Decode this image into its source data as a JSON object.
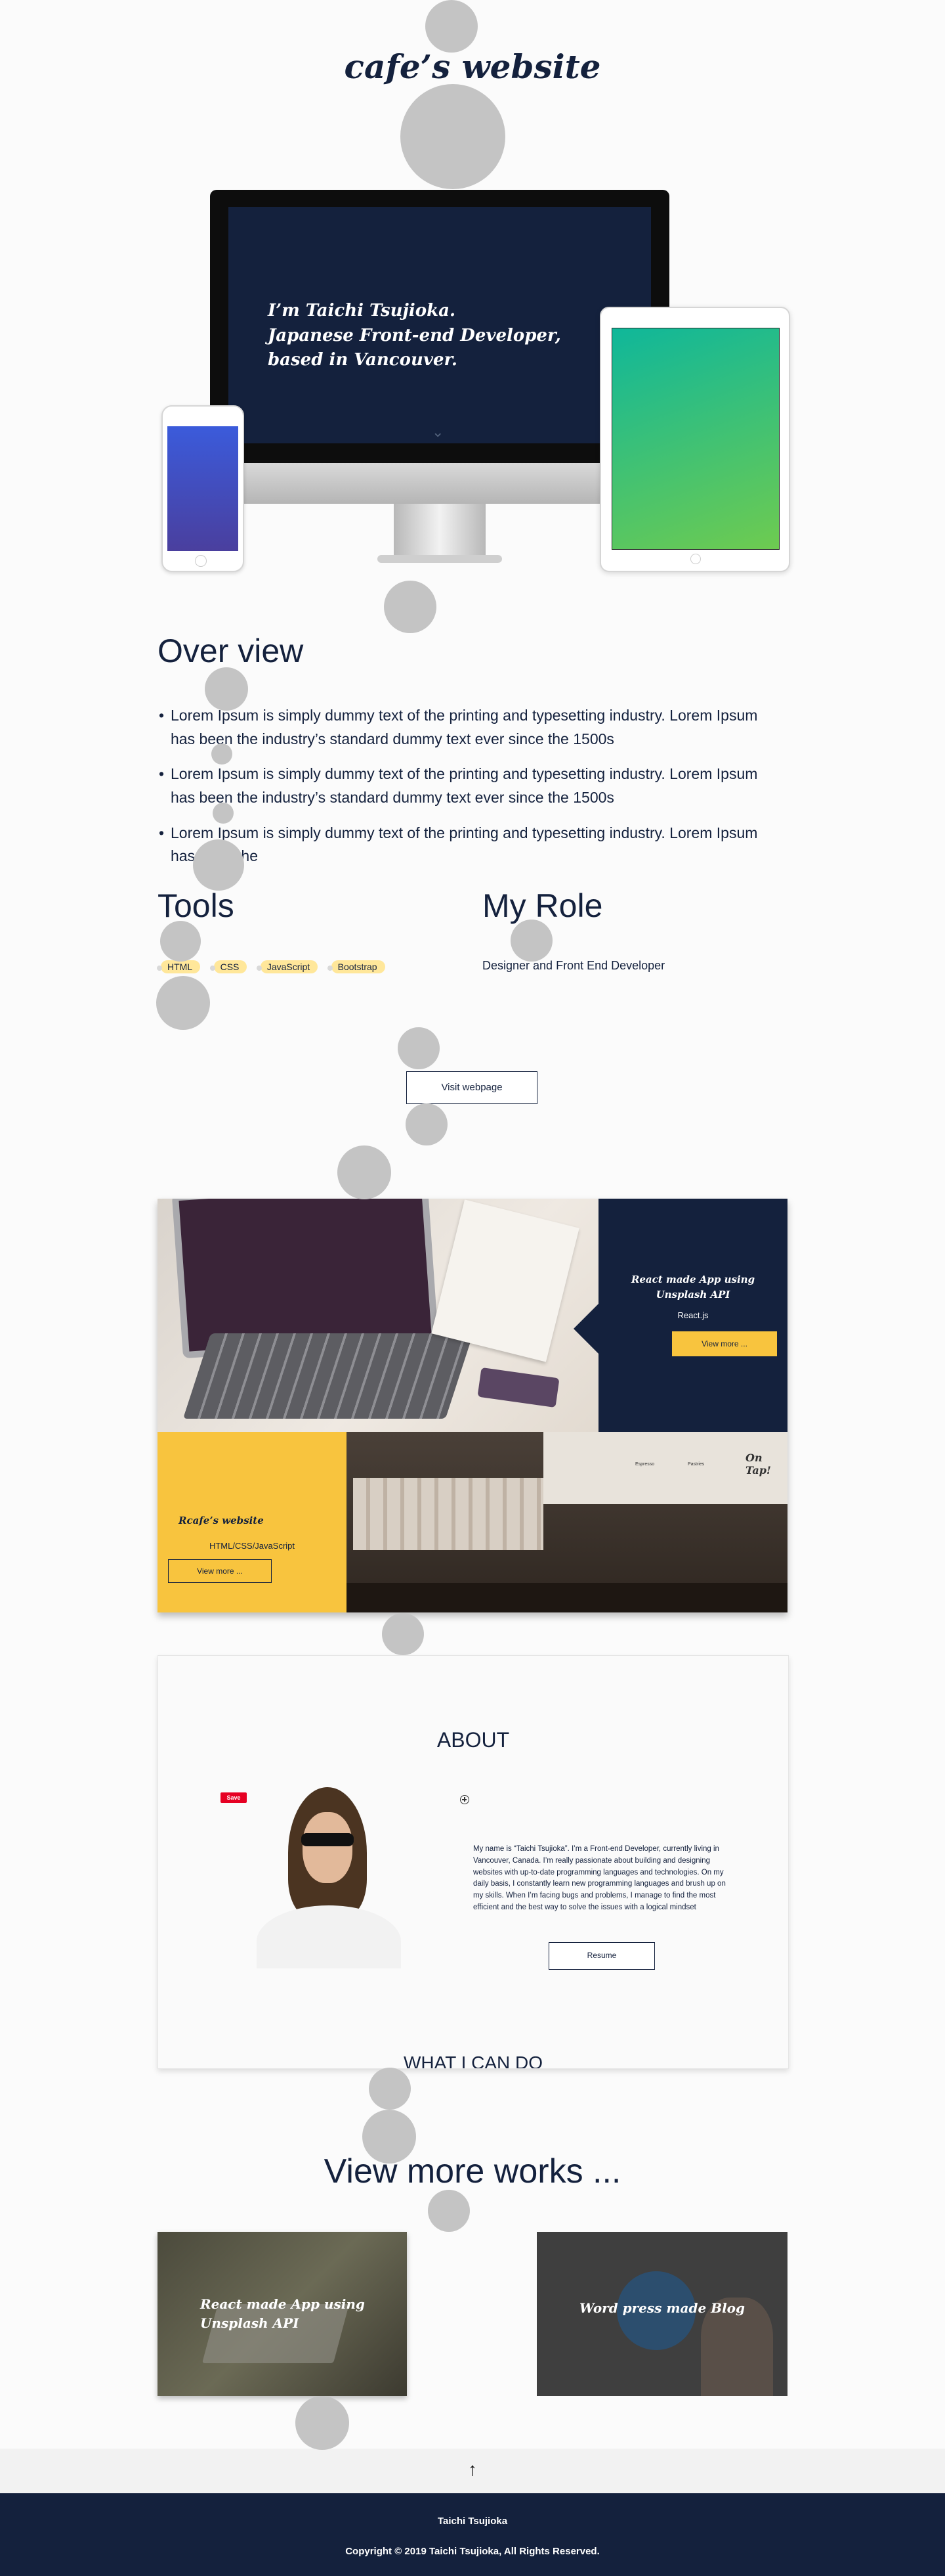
{
  "header": {
    "site_title": "cafe’s website"
  },
  "hero": {
    "intro_line1": "I’m Taichi Tsujioka.",
    "intro_line2": "Japanese Front-end Developer,",
    "intro_line3": "based in Vancouver.",
    "scroll_hint": "⌄"
  },
  "overview": {
    "title": "Over view",
    "bullets": [
      "Lorem Ipsum is simply dummy text of the printing and typesetting industry. Lorem Ipsum has been the industry’s standard dummy text ever since the 1500s",
      "Lorem Ipsum is simply dummy text of the printing and typesetting industry. Lorem Ipsum has been the industry’s standard dummy text ever since the 1500s",
      "Lorem Ipsum is simply dummy text of the printing and typesetting industry. Lorem Ipsum has been the"
    ]
  },
  "tools": {
    "title": "Tools",
    "items": [
      "HTML",
      "CSS",
      "JavaScript",
      "Bootstrap"
    ]
  },
  "role": {
    "title": "My Role",
    "text": "Designer and Front End Developer"
  },
  "visit_button": "Visit webpage",
  "works": {
    "card1": {
      "title_line1": "React made App using",
      "title_line2": "Unsplash API",
      "stack": "React.js",
      "button": "View more ..."
    },
    "card2": {
      "title": "Rcafe’s website",
      "stack": "HTML/CSS/JavaScript",
      "button": "View more ..."
    },
    "cafe_signs": {
      "espresso": "Espresso",
      "pastries": "Pastries",
      "on_tap": "On Tap!"
    }
  },
  "about": {
    "title": "ABOUT",
    "save_badge": "Save",
    "body": "My name is “Taichi Tsujioka”. I’m a Front-end Developer, currently living in Vancouver, Canada. I’m really passionate about building and designing websites with up-to-date programming languages and technologies. On my daily basis, I constantly learn new programming languages and brush up on my skills. When I’m facing bugs and problems, I manage to find the most efficient and the best way to solve the issues with a logical mindset",
    "resume_button": "Resume",
    "next_heading": "WHAT I CAN DO"
  },
  "more_works": {
    "title": "View more works ...",
    "card1_line1": "React made App using",
    "card1_line2": "Unsplash API",
    "card2": "Word press made Blog"
  },
  "back_to_top": "↑",
  "footer": {
    "name": "Taichi Tsujioka",
    "copyright": "Copyright © 2019 Taichi Tsujioka, All Rights Reserved."
  },
  "colors": {
    "navy": "#14213d",
    "yellow": "#f8c43e",
    "tag_yellow": "#ffe79a",
    "background": "#fbfbfb"
  }
}
